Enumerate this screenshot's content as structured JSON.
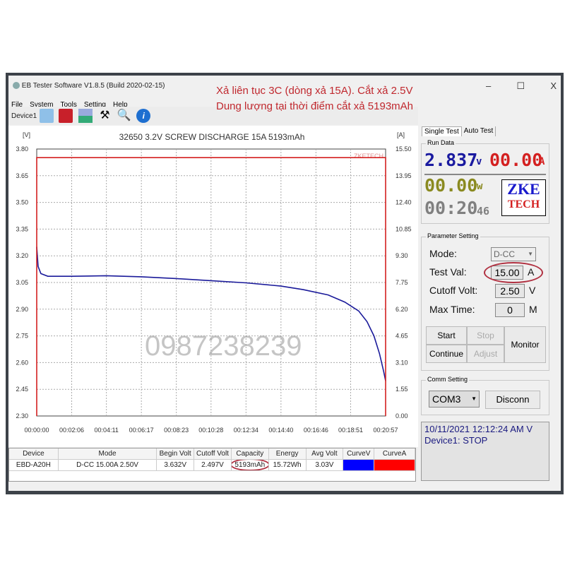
{
  "window": {
    "title": "EB Tester Software V1.8.5 (Build 2020-02-15)",
    "controls": [
      "–",
      "☐",
      "X"
    ]
  },
  "menu": [
    "File",
    "System",
    "Tools",
    "Setting",
    "Help"
  ],
  "toolbar": {
    "device": "Device1",
    "icons": [
      "folder-icon",
      "save-icon",
      "chart-icon",
      "tools-icon",
      "search-icon",
      "info-icon"
    ]
  },
  "annotation": {
    "line1": "Xả liên tục 3C (dòng xả 15A). Cắt xả 2.5V",
    "line2": "Dung lượng tại thời điểm cắt xả 5193mAh"
  },
  "watermark": "0987238239",
  "chart_data": {
    "type": "line",
    "title": "32650 3.2V SCREW DISCHARGE 15A 5193mAh",
    "ylabel_left": "[V]",
    "ylabel_right": "[A]",
    "corner_label": "ZKETECH",
    "ylim_left": [
      2.3,
      3.8
    ],
    "ylim_right": [
      0,
      15.5
    ],
    "yticks_left": [
      "3.80",
      "3.65",
      "3.50",
      "3.35",
      "3.20",
      "3.05",
      "2.90",
      "2.75",
      "2.60",
      "2.45",
      "2.30"
    ],
    "yticks_right": [
      "15.50",
      "13.95",
      "12.40",
      "10.85",
      "9.30",
      "7.75",
      "6.20",
      "4.65",
      "3.10",
      "1.55",
      "0.00"
    ],
    "xticks": [
      "00:00:00",
      "00:02:06",
      "00:04:11",
      "00:06:17",
      "00:08:23",
      "00:10:28",
      "00:12:34",
      "00:14:40",
      "00:16:46",
      "00:18:51",
      "00:20:57"
    ],
    "grid": true,
    "series": [
      {
        "axis": "left",
        "color": "#1a1a9a",
        "points": [
          [
            "00:00:00",
            3.25
          ],
          [
            "00:00:05",
            3.14
          ],
          [
            "00:00:15",
            3.1
          ],
          [
            "00:00:40",
            3.085
          ],
          [
            "00:02:06",
            3.085
          ],
          [
            "00:04:11",
            3.088
          ],
          [
            "00:06:17",
            3.082
          ],
          [
            "00:08:23",
            3.072
          ],
          [
            "00:10:28",
            3.06
          ],
          [
            "00:12:34",
            3.048
          ],
          [
            "00:14:40",
            3.03
          ],
          [
            "00:16:00",
            3.01
          ],
          [
            "00:17:30",
            2.98
          ],
          [
            "00:18:30",
            2.94
          ],
          [
            "00:19:20",
            2.89
          ],
          [
            "00:19:50",
            2.83
          ],
          [
            "00:20:15",
            2.75
          ],
          [
            "00:20:35",
            2.65
          ],
          [
            "00:20:50",
            2.55
          ],
          [
            "00:20:57",
            2.497
          ]
        ]
      },
      {
        "axis": "right",
        "color": "#d42020",
        "points": [
          [
            "00:00:00",
            0
          ],
          [
            "00:00:00",
            15.0
          ],
          [
            "00:20:57",
            15.0
          ],
          [
            "00:20:57",
            0
          ]
        ]
      }
    ]
  },
  "table": {
    "headers": [
      "Device",
      "Mode",
      "Begin Volt",
      "Cutoff Volt",
      "Capacity",
      "Energy",
      "Avg Volt",
      "CurveV",
      "CurveA"
    ],
    "rows": [
      [
        "EBD-A20H",
        "D-CC  15.00A  2.50V",
        "3.632V",
        "2.497V",
        "5193mAh",
        "15.72Wh",
        "3.03V",
        "",
        ""
      ]
    ],
    "curve_colors": [
      "#0000ff",
      "#ff0000"
    ]
  },
  "panel": {
    "tabs": [
      "Single Test",
      "Auto Test"
    ],
    "run_data": {
      "label": "Run Data",
      "voltage": "2.837",
      "v_unit": "v",
      "current": "00.00",
      "a_unit": "A",
      "power": "00.00",
      "w_unit": "w",
      "time": "00:20",
      "seconds": "46",
      "logo": "ZKE",
      "logo2": "TECH"
    },
    "params": {
      "label": "Parameter Setting",
      "mode_label": "Mode:",
      "mode": "D-CC",
      "test_label": "Test Val:",
      "test_val": "15.00",
      "test_unit": "A",
      "cutoff_label": "Cutoff Volt:",
      "cutoff_val": "2.50",
      "cutoff_unit": "V",
      "maxtime_label": "Max Time:",
      "maxtime_val": "0",
      "maxtime_unit": "M"
    },
    "buttons": {
      "start": "Start",
      "stop": "Stop",
      "monitor": "Monitor",
      "continue": "Continue",
      "adjust": "Adjust"
    },
    "comm": {
      "label": "Comm Setting",
      "port": "COM3",
      "disconn": "Disconn"
    },
    "log": {
      "line1": "10/11/2021 12:12:24 AM  V",
      "line2": "Device1: STOP"
    }
  },
  "colors": {
    "voltage": "#1a1a9a",
    "current": "#d42020",
    "power": "#8a8a20",
    "time": "#808080",
    "annotation": "#c0282e"
  }
}
